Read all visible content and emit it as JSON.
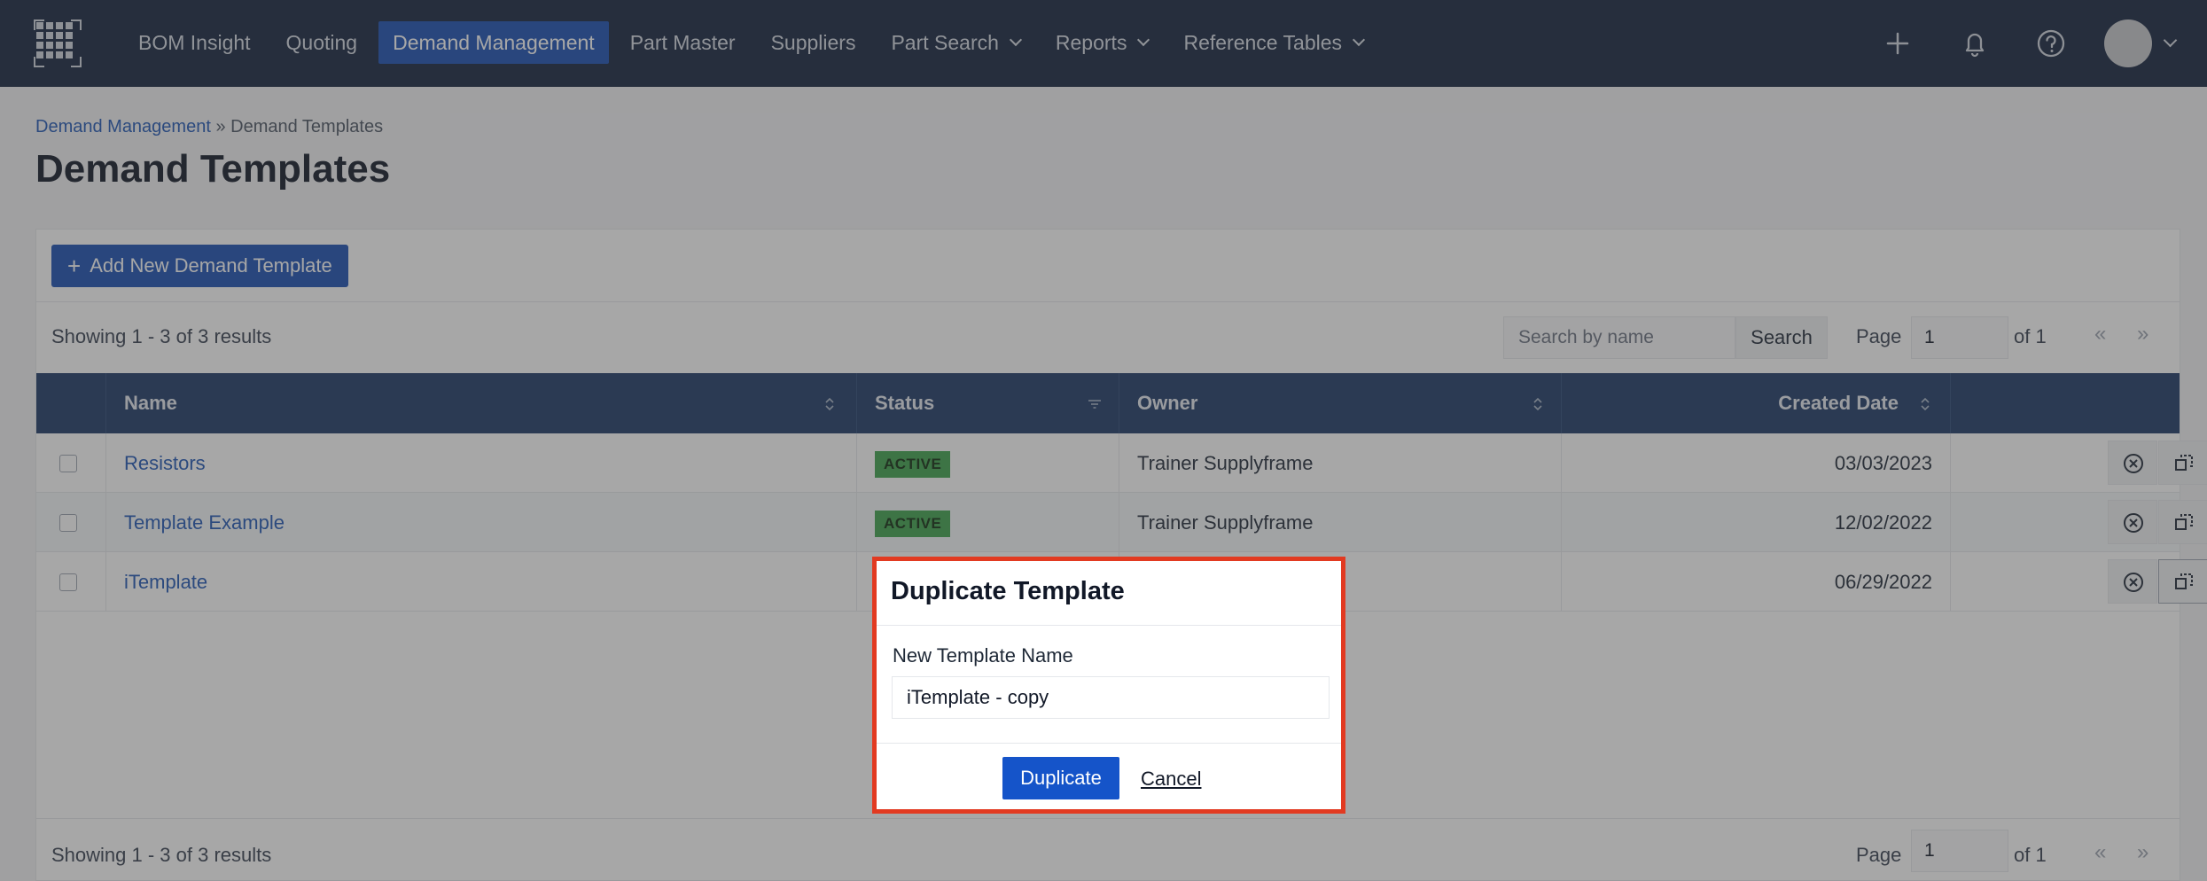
{
  "nav": {
    "items": [
      {
        "label": "BOM Insight",
        "active": false,
        "dropdown": false
      },
      {
        "label": "Quoting",
        "active": false,
        "dropdown": false
      },
      {
        "label": "Demand Management",
        "active": true,
        "dropdown": false
      },
      {
        "label": "Part Master",
        "active": false,
        "dropdown": false
      },
      {
        "label": "Suppliers",
        "active": false,
        "dropdown": false
      },
      {
        "label": "Part Search",
        "active": false,
        "dropdown": true
      },
      {
        "label": "Reports",
        "active": false,
        "dropdown": true
      },
      {
        "label": "Reference Tables",
        "active": false,
        "dropdown": true
      }
    ],
    "right_icons": [
      "plus-icon",
      "bell-icon",
      "help-icon",
      "avatar"
    ]
  },
  "breadcrumb": {
    "parent": "Demand Management",
    "separator": "»",
    "current": "Demand Templates"
  },
  "page": {
    "title": "Demand Templates"
  },
  "toolbar": {
    "add_label": "Add New Demand Template"
  },
  "results": {
    "showing": "Showing 1 - 3 of 3 results",
    "search_placeholder": "Search by name",
    "search_label": "Search",
    "page_label": "Page",
    "page_value": "1",
    "of_label": "of 1",
    "prev": "«",
    "next": "»"
  },
  "table": {
    "columns": [
      "Name",
      "Status",
      "Owner",
      "Created Date"
    ],
    "rows": [
      {
        "name": "Resistors",
        "status": "ACTIVE",
        "owner": "Trainer Supplyframe",
        "created": "03/03/2023"
      },
      {
        "name": "Template Example",
        "status": "ACTIVE",
        "owner": "Trainer Supplyframe",
        "created": "12/02/2022"
      },
      {
        "name": "iTemplate",
        "status": "",
        "owner": "",
        "created": "06/29/2022"
      }
    ]
  },
  "modal": {
    "title": "Duplicate Template",
    "field_label": "New Template Name",
    "field_value": "iTemplate - copy",
    "duplicate_label": "Duplicate",
    "cancel_label": "Cancel"
  },
  "colors": {
    "nav_bg": "#15233e",
    "accent": "#1b4fb2",
    "header_bg": "#1e3a66",
    "badge": "#3fa34d",
    "highlight": "#e23a21"
  }
}
